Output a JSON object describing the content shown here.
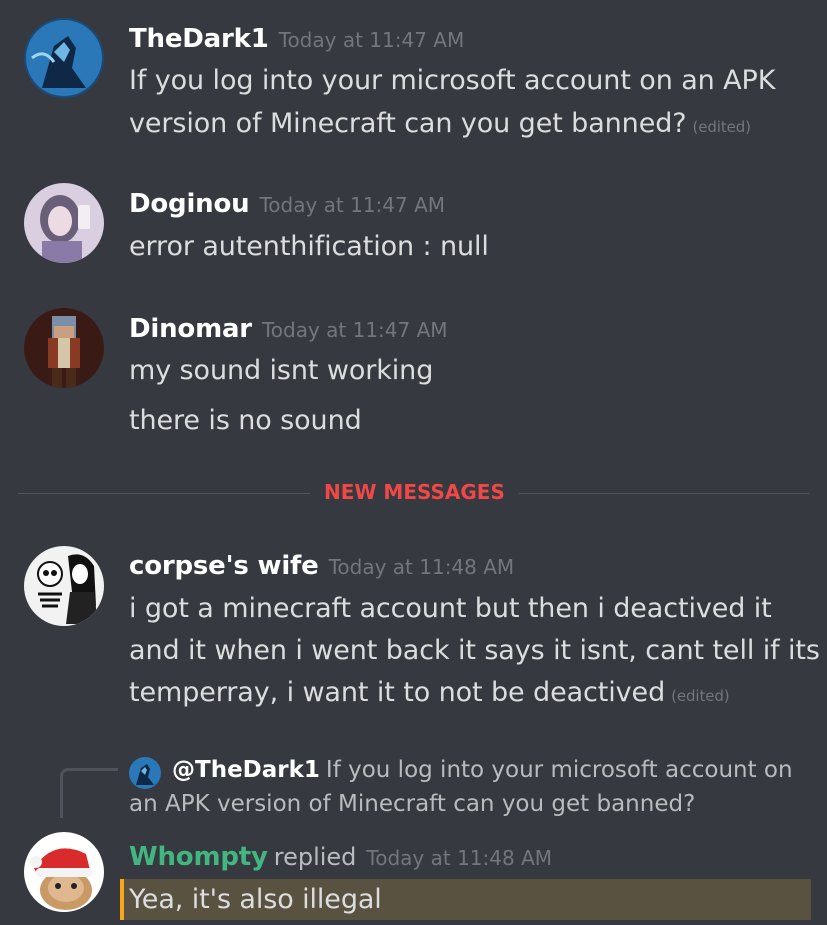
{
  "messages": [
    {
      "username": "TheDark1",
      "timestamp": "Today at 11:47 AM",
      "lines": [
        "If you log into your microsoft account on an APK",
        "version of Minecraft can you get banned?"
      ],
      "edited": "(edited)"
    },
    {
      "username": "Doginou",
      "timestamp": "Today at 11:47 AM",
      "lines": [
        "error autenthification : null"
      ]
    },
    {
      "username": "Dinomar",
      "timestamp": "Today at 11:47 AM",
      "lines": [
        "my sound isnt working",
        "there is no sound"
      ]
    },
    {
      "username": "corpse's wife",
      "timestamp": "Today at 11:48 AM",
      "lines": [
        "i got a minecraft account but then i deactived it",
        "and it when i went back it says it isnt, cant tell if its",
        "temperray, i want it to not be deactived"
      ],
      "edited": "(edited)"
    }
  ],
  "divider": {
    "label": "NEW MESSAGES"
  },
  "reply": {
    "ref_user": "@TheDark1",
    "ref_text_1": "If you log into your microsoft account on",
    "ref_text_2": "an APK version of Minecraft can you get banned?",
    "username": "Whompty",
    "username_color": "#43b581",
    "replied_label": "replied",
    "timestamp": "Today at 11:48 AM",
    "text": "Yea, it's also illegal"
  },
  "colors": {
    "background": "#36393f",
    "new_messages": "#f04747",
    "mention_highlight": "#5a5241",
    "mention_bar": "#faa61a"
  }
}
